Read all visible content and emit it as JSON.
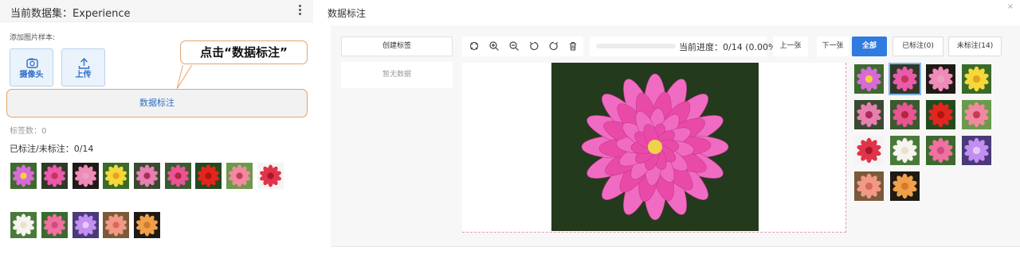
{
  "left_panel": {
    "title": "当前数据集：Experience",
    "sample_label": "添加图片样本:",
    "camera_label": "摄像头",
    "upload_label": "上传",
    "annotate_label": "数据标注",
    "callout_text": "点击“数据标注”",
    "tag_count": "标签数：0",
    "annotated_status": "已标注/未标注：0/14"
  },
  "dialog": {
    "title": "数据标注",
    "close_label": "×",
    "create_tag_label": "创建标签",
    "no_data_label": "暂无数据",
    "progress_text": "当前进度：0/14 (0.00%)",
    "progress_value": 0,
    "prev_label": "上一张",
    "next_label": "下一张",
    "filter_all_label": "全部",
    "filter_annotated_label": "已标注(0)",
    "filter_unannotated_label": "未标注(14)"
  },
  "toolbar_icons": [
    "fit-icon",
    "zoom-in-icon",
    "zoom-out-icon",
    "rotate-left-icon",
    "rotate-right-icon",
    "delete-icon"
  ],
  "thumbnails": [
    {
      "name": "purple-daisy",
      "bg": "#3e6a2e",
      "petal": "#d86ad8",
      "center": "#f2d23a"
    },
    {
      "name": "pink-dahlia",
      "bg": "#2e3a28",
      "petal": "#ea5ba8",
      "center": "#c8325f"
    },
    {
      "name": "pink-ball-dahlia",
      "bg": "#1e1a14",
      "petal": "#f08ab8",
      "center": "#e9a1c2"
    },
    {
      "name": "yellow-flower",
      "bg": "#3a6a2a",
      "petal": "#f5d83a",
      "center": "#e6a21c"
    },
    {
      "name": "pink-lily",
      "bg": "#3a4a30",
      "petal": "#e680b0",
      "center": "#b0295e"
    },
    {
      "name": "pink-dahlia-2",
      "bg": "#3a5a30",
      "petal": "#e85592",
      "center": "#b3263e"
    },
    {
      "name": "red-flower",
      "bg": "#234a1e",
      "petal": "#e2261e",
      "center": "#b01510"
    },
    {
      "name": "pink-hibiscus",
      "bg": "#6a9a4a",
      "petal": "#f18aa0",
      "center": "#c83a5a"
    },
    {
      "name": "red-rose",
      "bg": "#f4f4f4",
      "petal": "#e0344a",
      "center": "#a8162a"
    },
    {
      "name": "white-rose",
      "bg": "#4a7a3a",
      "petal": "#f7f3ee",
      "center": "#e8e2cc"
    },
    {
      "name": "pink-rose",
      "bg": "#3a6a2e",
      "petal": "#f070a0",
      "center": "#d14a7e"
    },
    {
      "name": "purple-lotus",
      "bg": "#4a3a78",
      "petal": "#c28ef0",
      "center": "#e6c8f8"
    },
    {
      "name": "coral-rose",
      "bg": "#7a5a3a",
      "petal": "#f09a86",
      "center": "#d96a5a"
    },
    {
      "name": "orange-rose",
      "bg": "#1e1a14",
      "petal": "#f0a04a",
      "center": "#d47a2a"
    }
  ],
  "main_image": {
    "bg": "#233a1c",
    "petal_outer": "#f06cc2",
    "petal_inner": "#e94aa8",
    "center": "#f0d24a"
  }
}
